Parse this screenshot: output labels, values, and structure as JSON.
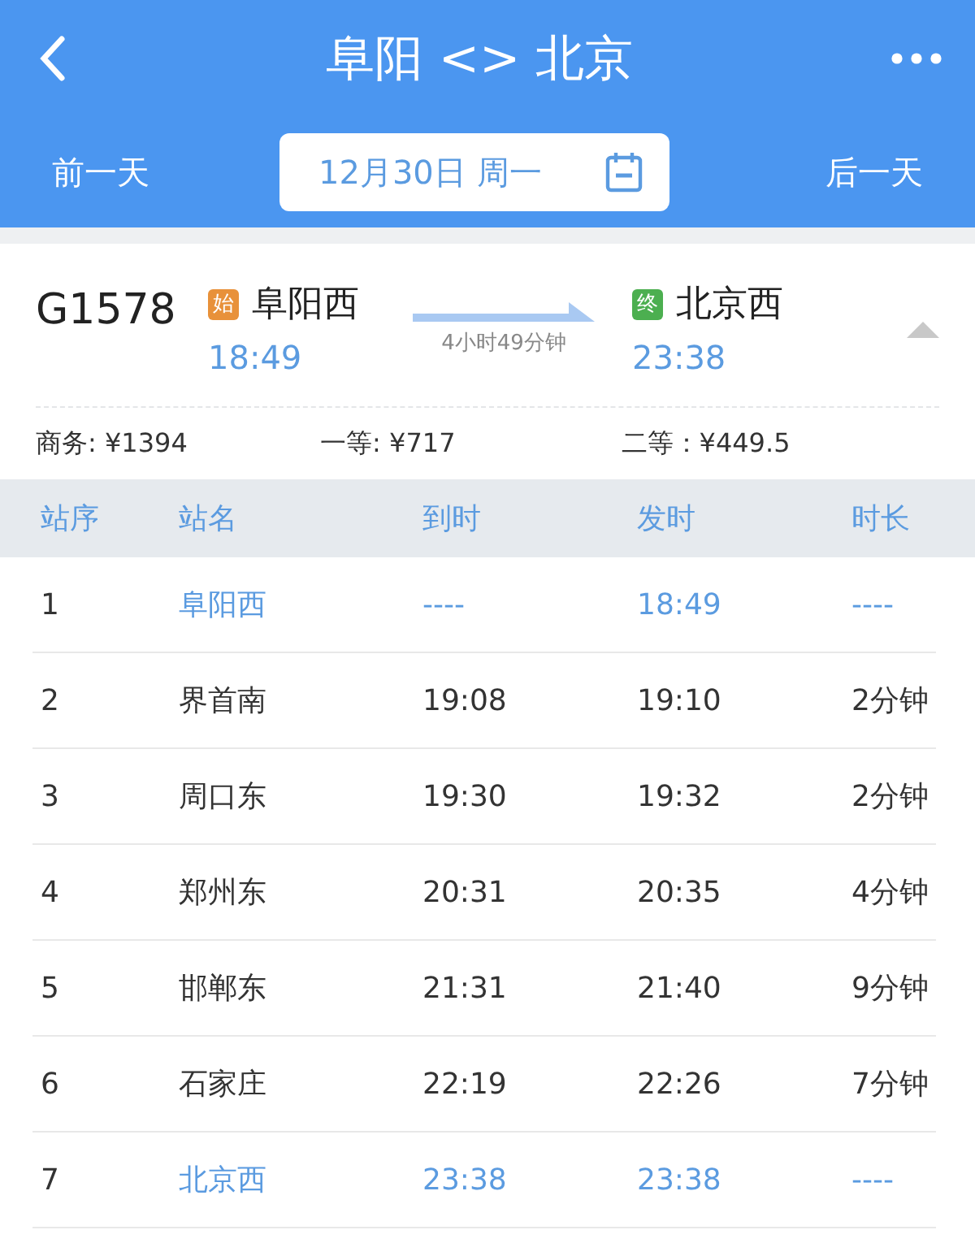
{
  "nav_bar": {
    "title": "阜阳 <> 北京",
    "prev_day": "前一天",
    "date": "12月30日 周一",
    "next_day": "后一天"
  },
  "train": {
    "number": "G1578",
    "origin": {
      "badge": "始",
      "color": "#e8913a",
      "station": "阜阳西",
      "time": "18:49"
    },
    "duration": "4小时49分钟",
    "destination": {
      "badge": "终",
      "color": "#4caf50",
      "station": "北京西",
      "time": "23:38"
    },
    "expanded": true,
    "prices": [
      "商务: ¥1394",
      "一等: ¥717",
      "二等：¥449.5"
    ]
  },
  "table": {
    "columns": [
      "站序",
      "站名",
      "到时",
      "发时",
      "时长"
    ],
    "rows": [
      {
        "kind": "terminal",
        "cells": [
          "1",
          "阜阳西",
          "----",
          "18:49",
          "----"
        ]
      },
      {
        "kind": "stop",
        "cells": [
          "2",
          "界首南",
          "19:08",
          "19:10",
          "2分钟"
        ]
      },
      {
        "kind": "stop",
        "cells": [
          "3",
          "周口东",
          "19:30",
          "19:32",
          "2分钟"
        ]
      },
      {
        "kind": "stop",
        "cells": [
          "4",
          "郑州东",
          "20:31",
          "20:35",
          "4分钟"
        ]
      },
      {
        "kind": "stop",
        "cells": [
          "5",
          "邯郸东",
          "21:31",
          "21:40",
          "9分钟"
        ]
      },
      {
        "kind": "stop",
        "cells": [
          "6",
          "石家庄",
          "22:19",
          "22:26",
          "7分钟"
        ]
      },
      {
        "kind": "terminal",
        "cells": [
          "7",
          "北京西",
          "23:38",
          "23:38",
          "----"
        ]
      }
    ]
  }
}
